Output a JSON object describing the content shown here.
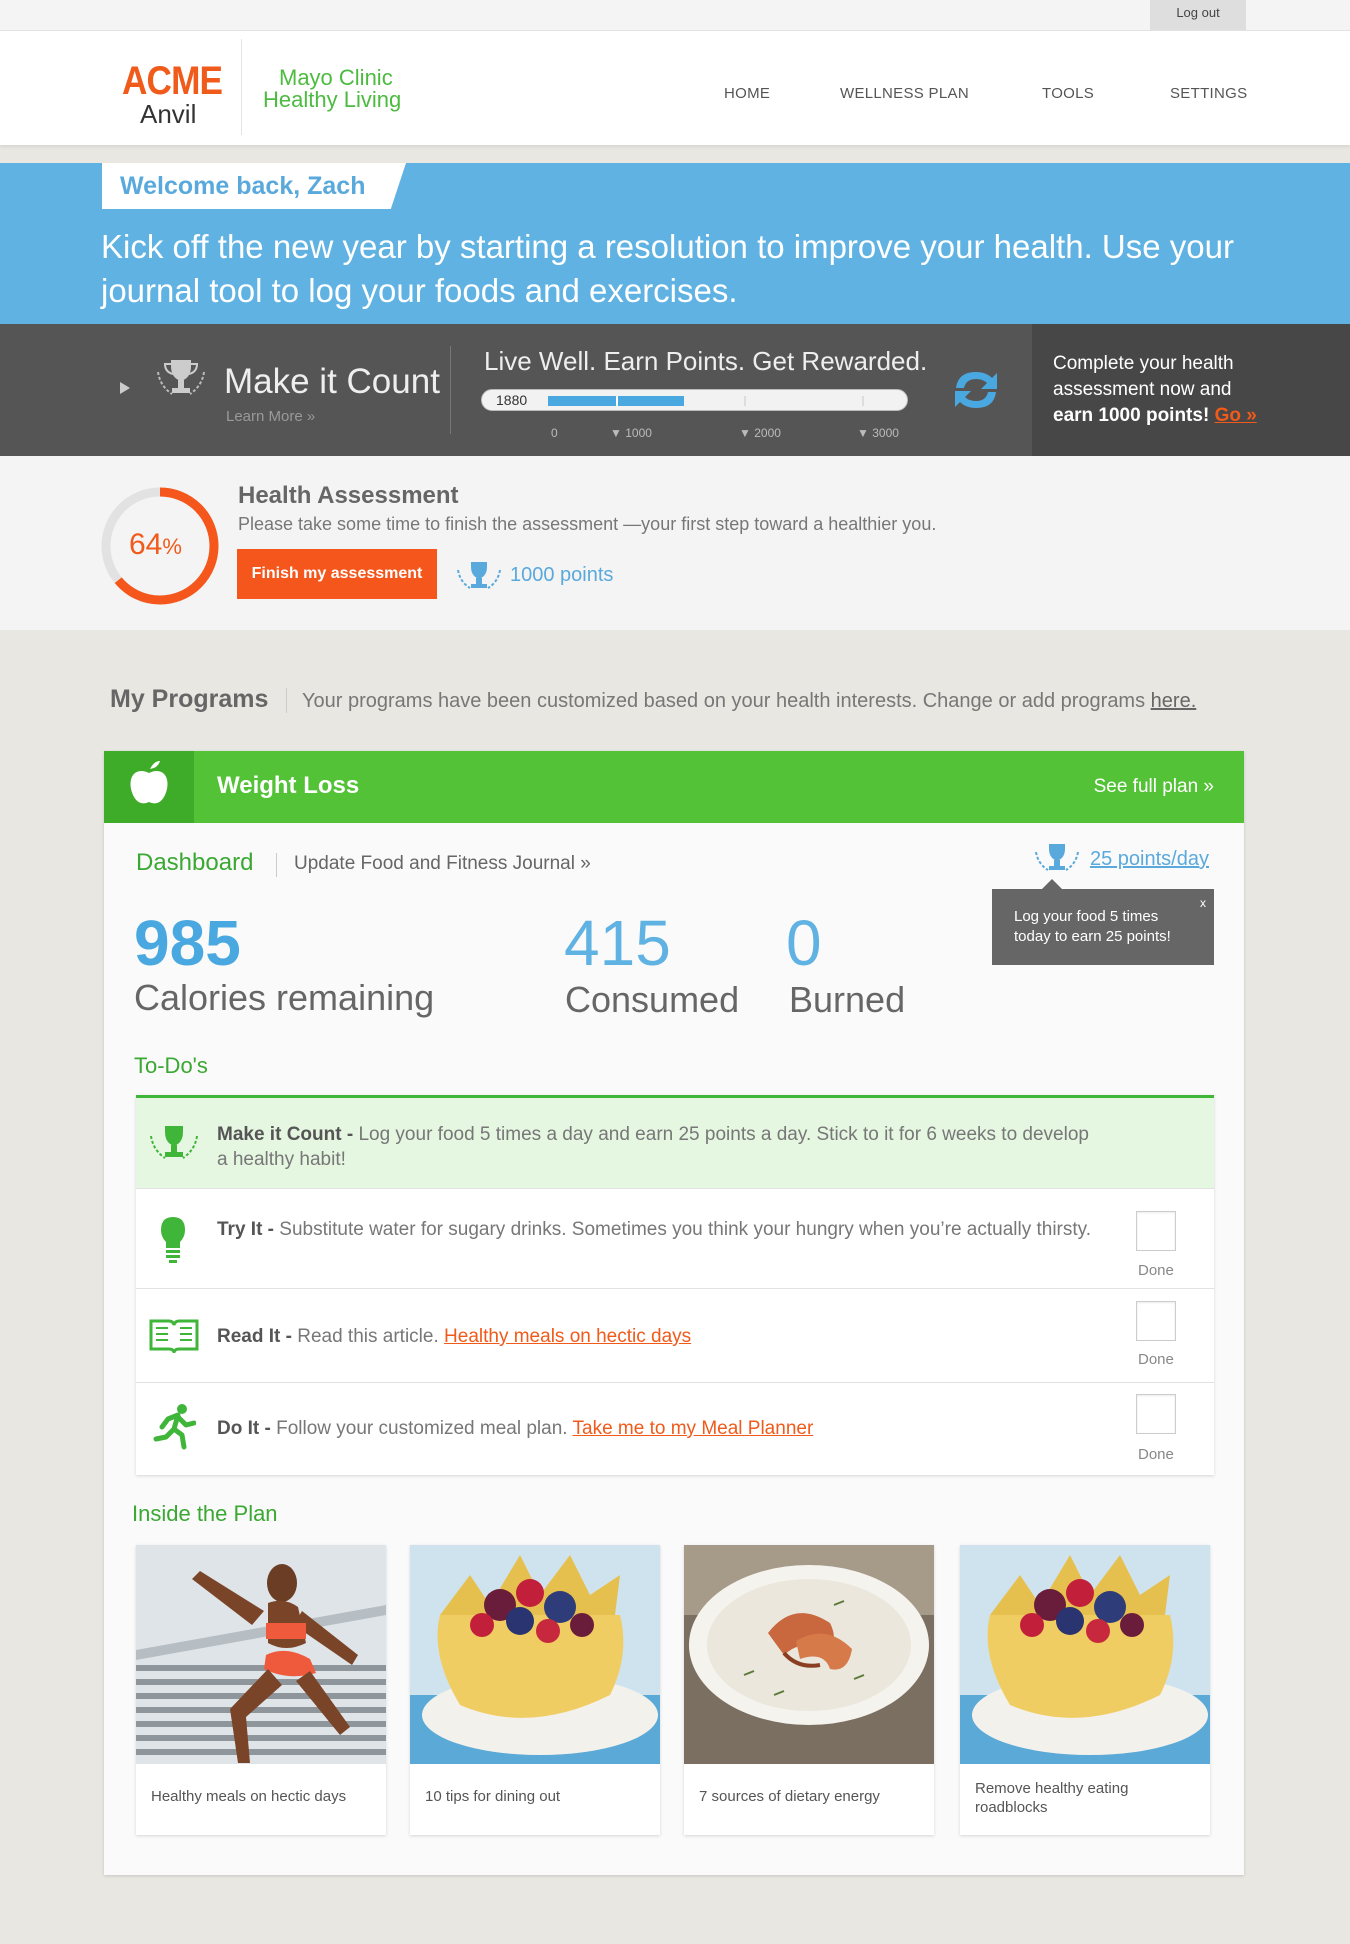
{
  "top": {
    "logout": "Log out"
  },
  "header": {
    "logo_acme": "ACME",
    "logo_anvil": "Anvil",
    "brand_line1": "Mayo Clinic",
    "brand_line2": "Healthy Living",
    "nav": [
      "HOME",
      "WELLNESS PLAN",
      "TOOLS",
      "SETTINGS"
    ]
  },
  "welcome": {
    "greeting": "Welcome back, Zach",
    "message": "Kick off the new year by starting a resolution to improve your health. Use your journal tool to log your foods and exercises."
  },
  "rewards": {
    "title": "Make it Count",
    "learn_more": "Learn More »",
    "slogan": "Live Well. Earn Points. Get Rewarded.",
    "current_points": "1880",
    "progress_fraction": 0.627,
    "milestones": [
      "0",
      "1000",
      "2000",
      "3000"
    ],
    "cta_line1": "Complete your health",
    "cta_line2": "assessment now and",
    "cta_line3": "earn 1000 points!",
    "cta_go": "Go »"
  },
  "assessment": {
    "percent_value": 64,
    "percent_number": "64",
    "percent_sign": "%",
    "title": "Health Assessment",
    "description": "Please take some time to finish the assessment —your first step toward a healthier you.",
    "button": "Finish my assessment",
    "points": "1000 points"
  },
  "programs": {
    "title": "My Programs",
    "description": "Your programs have been customized based on your health interests. Change or add programs",
    "link": "here."
  },
  "program": {
    "name": "Weight Loss",
    "full_plan": "See full plan »",
    "tab_dashboard": "Dashboard",
    "tab_journal": "Update Food and Fitness Journal »",
    "points_per_day": "25 points/day",
    "tooltip_line1": "Log your food 5 times",
    "tooltip_line2": "today to earn 25 points!",
    "tooltip_close": "x",
    "calories_remaining": "985",
    "calories_label": "Calories remaining",
    "consumed": "415",
    "consumed_label": "Consumed",
    "burned": "0",
    "burned_label": "Burned",
    "todos_title": "To-Do's",
    "todos": [
      {
        "title": "Make it Count -",
        "text": "Log your food 5 times a day and earn 25 points a day. Stick to it for 6 weeks to develop a healthy habit!",
        "link": ""
      },
      {
        "title": "Try It -",
        "text": "Substitute water for sugary drinks. Sometimes you think your hungry when you’re actually thirsty.",
        "link": "",
        "done": "Done"
      },
      {
        "title": "Read It -",
        "text": "Read this article.",
        "link": "Healthy meals on hectic days",
        "done": "Done"
      },
      {
        "title": "Do It -",
        "text": "Follow your customized meal plan.",
        "link": "Take me to my Meal Planner",
        "done": "Done"
      }
    ],
    "inside_title": "Inside the Plan",
    "articles": [
      {
        "caption": "Healthy meals on hectic days"
      },
      {
        "caption": "10 tips for dining out"
      },
      {
        "caption": "7 sources of dietary energy"
      },
      {
        "caption": "Remove healthy eating roadblocks"
      }
    ]
  },
  "colors": {
    "orange": "#f05a1a",
    "green": "#53c236",
    "blue": "#5fb2e2",
    "dark": "#555555"
  }
}
